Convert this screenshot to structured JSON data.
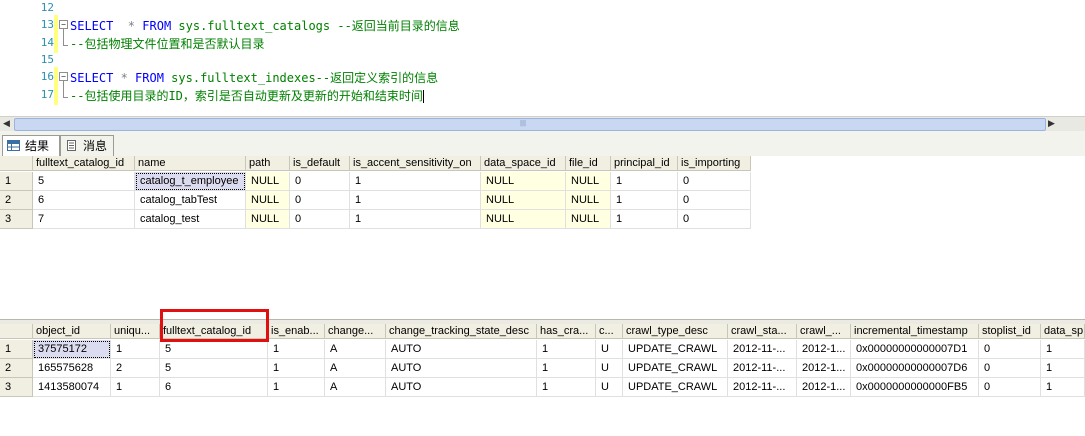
{
  "editor": {
    "line_numbers": [
      "12",
      "13",
      "14",
      "15",
      "16",
      "17"
    ],
    "line13": {
      "kw1": "SELECT",
      "star": "  * ",
      "kw2": "FROM",
      "obj": " sys.fulltext_catalogs",
      "comment": " --返回当前目录的信息"
    },
    "line14": {
      "comment": "--包括物理文件位置和是否默认目录"
    },
    "line16": {
      "kw1": "SELECT",
      "star": " * ",
      "kw2": "FROM",
      "obj": " sys.fulltext_indexes",
      "comment": "--返回定义索引的信息"
    },
    "line17": {
      "comment": "--包括使用目录的ID，索引是否自动更新及更新的开始和结束时间"
    }
  },
  "tabs": {
    "results_label": "结果",
    "messages_label": "消息"
  },
  "grid1": {
    "columns": [
      "fulltext_catalog_id",
      "name",
      "path",
      "is_default",
      "is_accent_sensitivity_on",
      "data_space_id",
      "file_id",
      "principal_id",
      "is_importing"
    ],
    "rows": [
      {
        "num": "1",
        "cells": [
          "5",
          "catalog_t_employee",
          "NULL",
          "0",
          "1",
          "NULL",
          "NULL",
          "1",
          "0"
        ]
      },
      {
        "num": "2",
        "cells": [
          "6",
          "catalog_tabTest",
          "NULL",
          "0",
          "1",
          "NULL",
          "NULL",
          "1",
          "0"
        ]
      },
      {
        "num": "3",
        "cells": [
          "7",
          "catalog_test",
          "NULL",
          "0",
          "1",
          "NULL",
          "NULL",
          "1",
          "0"
        ]
      }
    ]
  },
  "grid2": {
    "columns": [
      "object_id",
      "uniqu...",
      "fulltext_catalog_id",
      "is_enab...",
      "change...",
      "change_tracking_state_desc",
      "has_cra...",
      "c...",
      "crawl_type_desc",
      "crawl_sta...",
      "crawl_...",
      "incremental_timestamp",
      "stoplist_id",
      "data_sp"
    ],
    "rows": [
      {
        "num": "1",
        "cells": [
          "37575172",
          "1",
          "5",
          "1",
          "A",
          "AUTO",
          "1",
          "U",
          "UPDATE_CRAWL",
          "2012-11-...",
          "2012-1...",
          "0x00000000000007D1",
          "0",
          "1"
        ]
      },
      {
        "num": "2",
        "cells": [
          "165575628",
          "2",
          "5",
          "1",
          "A",
          "AUTO",
          "1",
          "U",
          "UPDATE_CRAWL",
          "2012-11-...",
          "2012-1...",
          "0x00000000000007D6",
          "0",
          "1"
        ]
      },
      {
        "num": "3",
        "cells": [
          "1413580074",
          "1",
          "6",
          "1",
          "A",
          "AUTO",
          "1",
          "U",
          "UPDATE_CRAWL",
          "2012-11-...",
          "2012-1...",
          "0x0000000000000FB5",
          "0",
          "1"
        ]
      }
    ]
  },
  "colors": {
    "keyword": "#0000ff",
    "object": "#008000",
    "comment": "#008000",
    "line_number": "#2b91af",
    "highlight_box": "#e01010",
    "null_cell_bg": "#ffffe1"
  }
}
